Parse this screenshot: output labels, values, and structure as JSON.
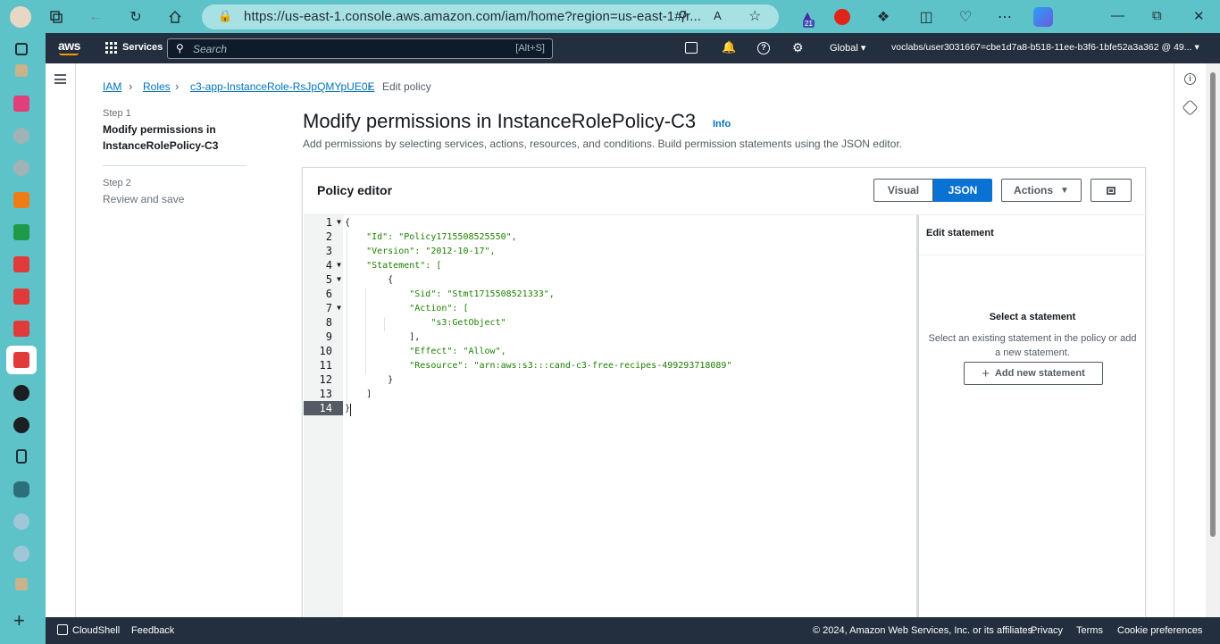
{
  "browser": {
    "url": "https://us-east-1.console.aws.amazon.com/iam/home?region=us-east-1#/r...",
    "badge_count": "21"
  },
  "aws_nav": {
    "logo": "aws",
    "services_label": "Services",
    "search_placeholder": "Search",
    "search_shortcut": "[Alt+S]",
    "region_label": "Global",
    "account_label": "voclabs/user3031667=cbe1d7a8-b518-11ee-b3f6-1bfe52a3a362 @ 49..."
  },
  "breadcrumb": {
    "items": [
      "IAM",
      "Roles",
      "c3-app-InstanceRole-RsJpQMYpUE0E"
    ],
    "current": "Edit policy"
  },
  "steps": [
    {
      "label": "Step 1",
      "title": "Modify permissions in InstanceRolePolicy-C3"
    },
    {
      "label": "Step 2",
      "title": "Review and save"
    }
  ],
  "page": {
    "title": "Modify permissions in InstanceRolePolicy-C3",
    "info": "Info",
    "description": "Add permissions by selecting services, actions, resources, and conditions. Build permission statements using the JSON editor."
  },
  "editor": {
    "title": "Policy editor",
    "visual_label": "Visual",
    "json_label": "JSON",
    "actions_label": "Actions",
    "line_numbers": [
      "1",
      "2",
      "3",
      "4",
      "5",
      "6",
      "7",
      "8",
      "9",
      "10",
      "11",
      "12",
      "13",
      "14"
    ],
    "lines": [
      "{",
      "    \"Id\": \"Policy1715508525550\",",
      "    \"Version\": \"2012-10-17\",",
      "    \"Statement\": [",
      "        {",
      "            \"Sid\": \"Stmt1715508521333\",",
      "            \"Action\": [",
      "                \"s3:GetObject\"",
      "            ],",
      "            \"Effect\": \"Allow\",",
      "            \"Resource\": \"arn:aws:s3:::cand-c3-free-recipes-499293718089\"",
      "        }",
      "    ]",
      "}"
    ],
    "active_line": 14
  },
  "statement_panel": {
    "header": "Edit statement",
    "select_title": "Select a statement",
    "select_desc": "Select an existing statement in the policy or add a new statement.",
    "add_button": "Add new statement"
  },
  "footer": {
    "cloudshell": "CloudShell",
    "feedback": "Feedback",
    "copyright": "© 2024, Amazon Web Services, Inc. or its affiliates.",
    "privacy": "Privacy",
    "terms": "Terms",
    "cookies": "Cookie preferences"
  },
  "colors": {
    "aws_nav": "#232f3e",
    "link": "#0073bb",
    "primary": "#0972d3",
    "browser_chrome": "#5ec3c8"
  }
}
